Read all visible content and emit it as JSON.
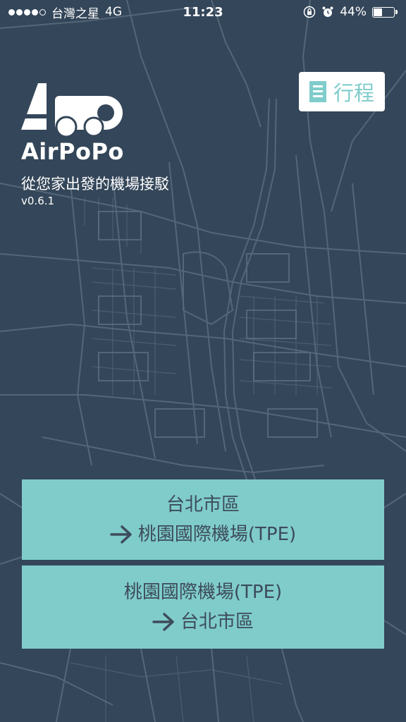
{
  "status_bar": {
    "carrier": "台灣之星",
    "network": "4G",
    "time": "11:23",
    "battery": "44%",
    "battery_level": 0.44,
    "signal_bars_filled": 4,
    "signal_bars_total": 5
  },
  "app": {
    "name": "AirPoPo",
    "tagline": "從您家出發的機場接駁",
    "version": "v0.6.1"
  },
  "header": {
    "itinerary_label": "行程"
  },
  "routes": [
    {
      "origin": "台北市區",
      "destination": "桃園國際機場(TPE)"
    },
    {
      "origin": "桃園國際機場(TPE)",
      "destination": "台北市區"
    }
  ],
  "colors": {
    "background": "#344659",
    "accent": "#7fcccb",
    "button_text": "#3d4b5a"
  },
  "icons": {
    "itinerary": "document-list-icon",
    "arrow": "arrow-right-icon"
  }
}
